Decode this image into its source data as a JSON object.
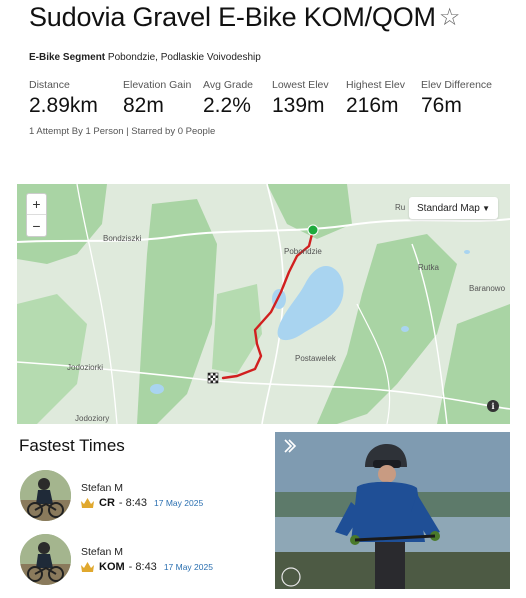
{
  "segment": {
    "title": "Sudovia Gravel E-Bike KOM/QOM",
    "star_icon": "star-outline-icon",
    "type_label": "E-Bike Segment",
    "location": "Pobondzie, Podlaskie Voivodeship"
  },
  "stats": [
    {
      "label": "Distance",
      "value": "2.89km"
    },
    {
      "label": "Elevation Gain",
      "value": "82m"
    },
    {
      "label": "Avg Grade",
      "value": "2.2%"
    },
    {
      "label": "Lowest Elev",
      "value": "139m"
    },
    {
      "label": "Highest Elev",
      "value": "216m"
    },
    {
      "label": "Elev Difference",
      "value": "76m"
    }
  ],
  "attempts_text": "1 Attempt By 1 Person | Starred by 0 People",
  "map": {
    "zoom_in": "+",
    "zoom_out": "−",
    "style_label": "Standard Map",
    "partial_label": "Ru",
    "info": "i",
    "places": [
      "Bondziszki",
      "Pobondzie",
      "Rutka",
      "Baranowo",
      "Jodoziorki",
      "Postawelek",
      "Jodoziory"
    ],
    "route_color": "#d11f1f",
    "start_color": "#1eaa3b"
  },
  "fastest": {
    "heading": "Fastest Times",
    "entries": [
      {
        "name": "Stefan M",
        "badge": "CR",
        "time": "- 8:43",
        "date": "17 May 2025"
      },
      {
        "name": "Stefan M",
        "badge": "KOM",
        "time": "- 8:43",
        "date": "17 May 2025"
      }
    ]
  },
  "colors": {
    "accent": "#2a6fb0",
    "crown": "#e0a82e"
  }
}
